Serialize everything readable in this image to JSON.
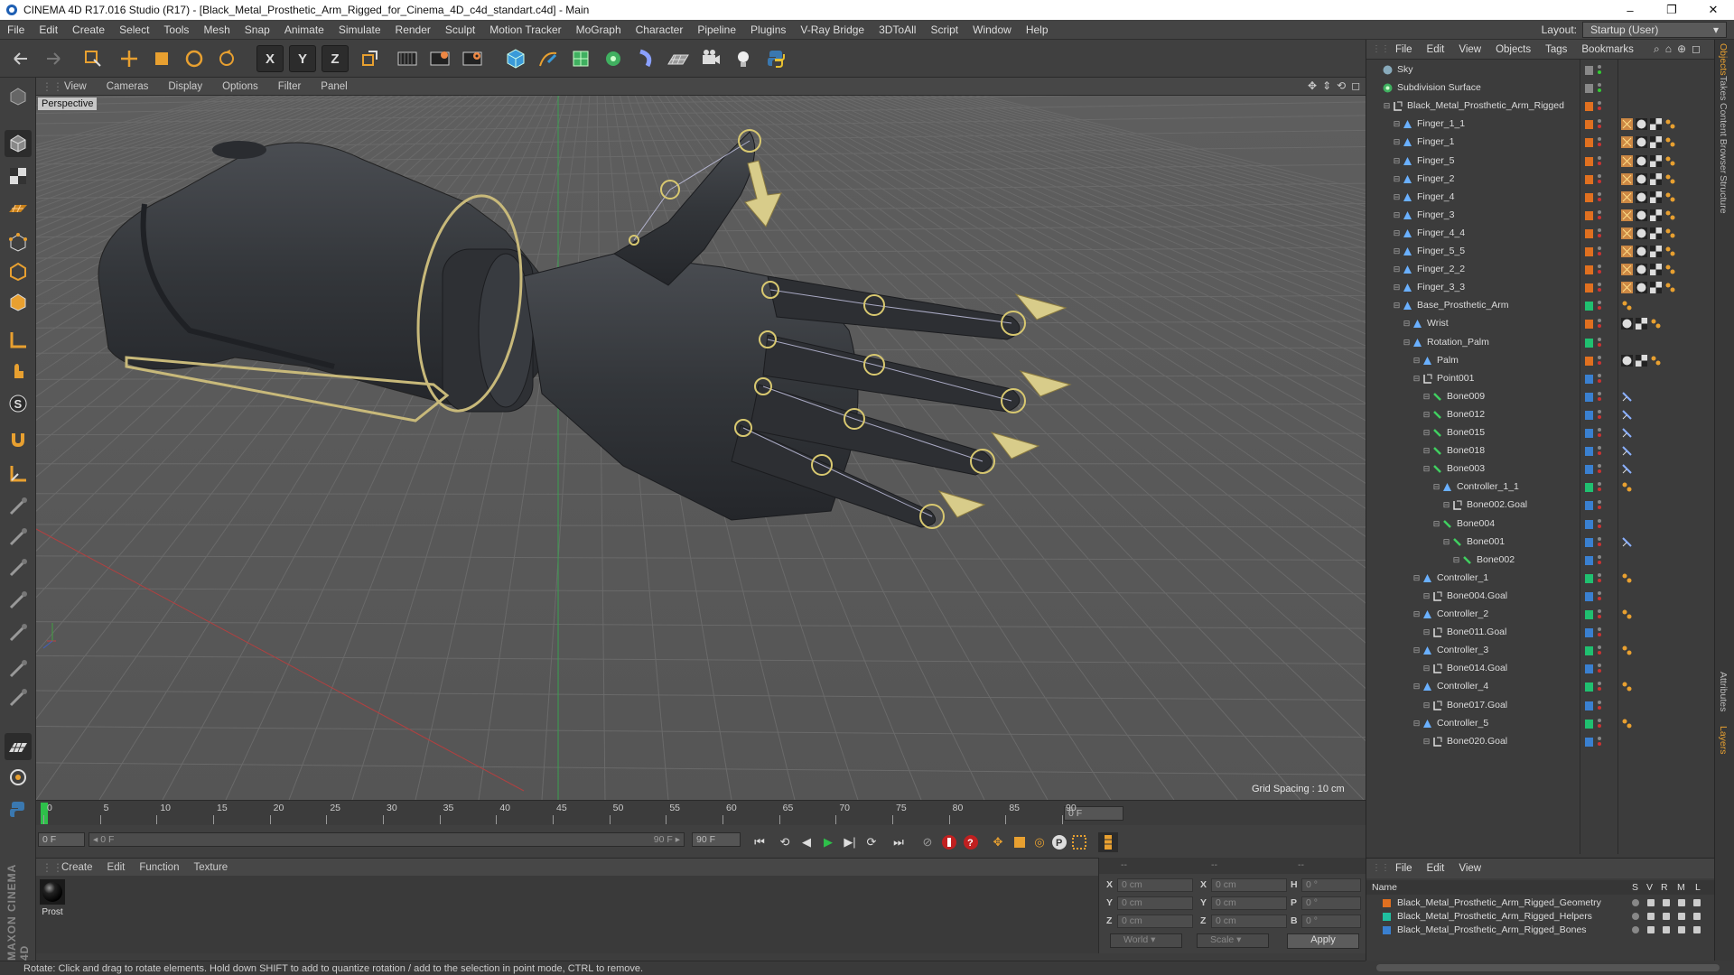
{
  "window": {
    "title": "CINEMA 4D R17.016 Studio (R17) - [Black_Metal_Prosthetic_Arm_Rigged_for_Cinema_4D_c4d_standart.c4d] - Main",
    "minimize": "–",
    "maximize": "❐",
    "close": "✕"
  },
  "menubar": {
    "items": [
      "File",
      "Edit",
      "Create",
      "Select",
      "Tools",
      "Mesh",
      "Snap",
      "Animate",
      "Simulate",
      "Render",
      "Sculpt",
      "Motion Tracker",
      "MoGraph",
      "Character",
      "Pipeline",
      "Plugins",
      "V-Ray Bridge",
      "3DToAll",
      "Script",
      "Window",
      "Help"
    ],
    "layout_label": "Layout:",
    "layout_value": "Startup (User)"
  },
  "toolbar": {
    "axis_x": "X",
    "axis_y": "Y",
    "axis_z": "Z"
  },
  "viewport": {
    "menu": [
      "View",
      "Cameras",
      "Display",
      "Options",
      "Filter",
      "Panel"
    ],
    "camera_label": "Perspective",
    "grid_spacing": "Grid Spacing : 10 cm"
  },
  "timeline": {
    "ticks": [
      "0",
      "5",
      "10",
      "15",
      "20",
      "25",
      "30",
      "35",
      "40",
      "45",
      "50",
      "55",
      "60",
      "65",
      "70",
      "75",
      "80",
      "85",
      "90"
    ],
    "current_frame_field": "0 F",
    "start_field": "0 F",
    "range_left": "◂ 0 F",
    "range_right": "90 F ▸",
    "end_field": "90 F",
    "end_field2": "90 F"
  },
  "material_manager": {
    "menu": [
      "Create",
      "Edit",
      "Function",
      "Texture"
    ],
    "material_name": "Prost"
  },
  "coordinates": {
    "header_left": "--",
    "header_mid": "--",
    "header_right": "--",
    "rows": [
      {
        "a": "X",
        "av": "0 cm",
        "b": "X",
        "bv": "0 cm",
        "c": "H",
        "cv": "0 °"
      },
      {
        "a": "Y",
        "av": "0 cm",
        "b": "Y",
        "bv": "0 cm",
        "c": "P",
        "cv": "0 °"
      },
      {
        "a": "Z",
        "av": "0 cm",
        "b": "Z",
        "bv": "0 cm",
        "c": "B",
        "cv": "0 °"
      }
    ],
    "mode": "World",
    "scale": "Scale",
    "apply": "Apply"
  },
  "status": "Rotate: Click and drag to rotate elements. Hold down SHIFT to add to quantize rotation / add to the selection in point mode, CTRL to remove.",
  "object_manager": {
    "menu": [
      "File",
      "Edit",
      "View",
      "Objects",
      "Tags",
      "Bookmarks"
    ],
    "objects": [
      {
        "name": "Sky",
        "depth": 0,
        "icon": "sky",
        "color": "#888888"
      },
      {
        "name": "Subdivision Surface",
        "depth": 0,
        "icon": "subdiv",
        "color": "#888888"
      },
      {
        "name": "Black_Metal_Prosthetic_Arm_Rigged",
        "depth": 1,
        "icon": "null",
        "color": "#e07020"
      },
      {
        "name": "Finger_1_1",
        "depth": 2,
        "icon": "joint",
        "color": "#e07020"
      },
      {
        "name": "Finger_1",
        "depth": 2,
        "icon": "joint",
        "color": "#e07020"
      },
      {
        "name": "Finger_5",
        "depth": 2,
        "icon": "joint",
        "color": "#e07020"
      },
      {
        "name": "Finger_2",
        "depth": 2,
        "icon": "joint",
        "color": "#e07020"
      },
      {
        "name": "Finger_4",
        "depth": 2,
        "icon": "joint",
        "color": "#e07020"
      },
      {
        "name": "Finger_3",
        "depth": 2,
        "icon": "joint",
        "color": "#e07020"
      },
      {
        "name": "Finger_4_4",
        "depth": 2,
        "icon": "joint",
        "color": "#e07020"
      },
      {
        "name": "Finger_5_5",
        "depth": 2,
        "icon": "joint",
        "color": "#e07020"
      },
      {
        "name": "Finger_2_2",
        "depth": 2,
        "icon": "joint",
        "color": "#e07020"
      },
      {
        "name": "Finger_3_3",
        "depth": 2,
        "icon": "joint",
        "color": "#e07020"
      },
      {
        "name": "Base_Prosthetic_Arm",
        "depth": 2,
        "icon": "joint",
        "color": "#20c070"
      },
      {
        "name": "Wrist",
        "depth": 3,
        "icon": "joint",
        "color": "#e07020"
      },
      {
        "name": "Rotation_Palm",
        "depth": 3,
        "icon": "joint",
        "color": "#20c070"
      },
      {
        "name": "Palm",
        "depth": 4,
        "icon": "joint",
        "color": "#e07020"
      },
      {
        "name": "Point001",
        "depth": 4,
        "icon": "null",
        "color": "#3a80d0"
      },
      {
        "name": "Bone009",
        "depth": 5,
        "icon": "bone",
        "color": "#3a80d0"
      },
      {
        "name": "Bone012",
        "depth": 5,
        "icon": "bone",
        "color": "#3a80d0"
      },
      {
        "name": "Bone015",
        "depth": 5,
        "icon": "bone",
        "color": "#3a80d0"
      },
      {
        "name": "Bone018",
        "depth": 5,
        "icon": "bone",
        "color": "#3a80d0"
      },
      {
        "name": "Bone003",
        "depth": 5,
        "icon": "bone",
        "color": "#3a80d0"
      },
      {
        "name": "Controller_1_1",
        "depth": 6,
        "icon": "joint",
        "color": "#20c070"
      },
      {
        "name": "Bone002.Goal",
        "depth": 7,
        "icon": "null",
        "color": "#3a80d0"
      },
      {
        "name": "Bone004",
        "depth": 6,
        "icon": "bone",
        "color": "#3a80d0"
      },
      {
        "name": "Bone001",
        "depth": 7,
        "icon": "bone",
        "color": "#3a80d0"
      },
      {
        "name": "Bone002",
        "depth": 8,
        "icon": "bone",
        "color": "#3a80d0"
      },
      {
        "name": "Controller_1",
        "depth": 4,
        "icon": "joint",
        "color": "#20c070"
      },
      {
        "name": "Bone004.Goal",
        "depth": 5,
        "icon": "null",
        "color": "#3a80d0"
      },
      {
        "name": "Controller_2",
        "depth": 4,
        "icon": "joint",
        "color": "#20c070"
      },
      {
        "name": "Bone011.Goal",
        "depth": 5,
        "icon": "null",
        "color": "#3a80d0"
      },
      {
        "name": "Controller_3",
        "depth": 4,
        "icon": "joint",
        "color": "#20c070"
      },
      {
        "name": "Bone014.Goal",
        "depth": 5,
        "icon": "null",
        "color": "#3a80d0"
      },
      {
        "name": "Controller_4",
        "depth": 4,
        "icon": "joint",
        "color": "#20c070"
      },
      {
        "name": "Bone017.Goal",
        "depth": 5,
        "icon": "null",
        "color": "#3a80d0"
      },
      {
        "name": "Controller_5",
        "depth": 4,
        "icon": "joint",
        "color": "#20c070"
      },
      {
        "name": "Bone020.Goal",
        "depth": 5,
        "icon": "null",
        "color": "#3a80d0"
      }
    ]
  },
  "layer_manager": {
    "menu": [
      "File",
      "Edit",
      "View"
    ],
    "columns": {
      "name": "Name",
      "s": "S",
      "v": "V",
      "r": "R",
      "m": "M",
      "l": "L"
    },
    "layers": [
      {
        "name": "Black_Metal_Prosthetic_Arm_Rigged_Geometry",
        "color": "#e07020"
      },
      {
        "name": "Black_Metal_Prosthetic_Arm_Rigged_Helpers",
        "color": "#20c0a0"
      },
      {
        "name": "Black_Metal_Prosthetic_Arm_Rigged_Bones",
        "color": "#3a80d0"
      }
    ]
  },
  "side_tabs": [
    "Objects",
    "Takes",
    "Content Browser",
    "Structure",
    "Attributes",
    "Layers"
  ],
  "brand": "MAXON CINEMA 4D"
}
